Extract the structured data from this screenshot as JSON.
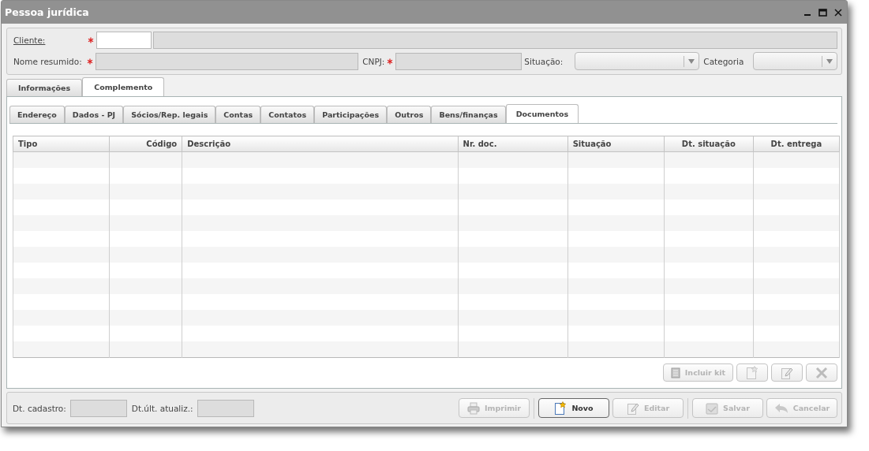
{
  "window": {
    "title": "Pessoa jurídica",
    "controls": [
      {
        "kind": "minimize"
      },
      {
        "kind": "maximize"
      },
      {
        "kind": "close"
      }
    ]
  },
  "header": {
    "cliente": {
      "label": "Cliente:",
      "required": true
    },
    "nome_resumido": {
      "label": "Nome resumido:",
      "required": true
    },
    "cnpj": {
      "label": "CNPJ:",
      "required": true
    },
    "situacao": {
      "label": "Situação:"
    },
    "categoria": {
      "label": "Categoria"
    }
  },
  "outer_tabs": [
    {
      "label": "Informações",
      "selected": false
    },
    {
      "label": "Complemento",
      "selected": true
    }
  ],
  "inner_tabs": [
    {
      "label": "Endereço",
      "selected": false
    },
    {
      "label": "Dados - PJ",
      "selected": false
    },
    {
      "label": "Sócios/Rep. legais",
      "selected": false
    },
    {
      "label": "Contas",
      "selected": false
    },
    {
      "label": "Contatos",
      "selected": false
    },
    {
      "label": "Participações",
      "selected": false
    },
    {
      "label": "Outros",
      "selected": false
    },
    {
      "label": "Bens/finanças",
      "selected": false
    },
    {
      "label": "Documentos",
      "selected": true
    }
  ],
  "table": {
    "columns": [
      "Tipo",
      "Código",
      "Descrição",
      "Nr. doc.",
      "Situação",
      "Dt. situação",
      "Dt. entrega"
    ]
  },
  "table_actions": [
    {
      "kind": "kit",
      "label": "Incluir kit",
      "disabled": true
    },
    {
      "kind": "new",
      "disabled": true
    },
    {
      "kind": "edit",
      "disabled": true
    },
    {
      "kind": "delete",
      "disabled": true
    }
  ],
  "footer": {
    "dt_cadastro": {
      "label": "Dt. cadastro:"
    },
    "dt_atualizacao": {
      "label": "Dt.últ. atualiz.:"
    },
    "buttons": [
      {
        "kind": "print",
        "label": "Imprimir",
        "disabled": true
      },
      {
        "kind": "new",
        "label": "Novo",
        "disabled": false
      },
      {
        "kind": "edit",
        "label": "Editar",
        "disabled": true
      },
      {
        "kind": "save",
        "label": "Salvar",
        "disabled": true
      },
      {
        "kind": "cancel",
        "label": "Cancelar",
        "disabled": true
      }
    ]
  }
}
